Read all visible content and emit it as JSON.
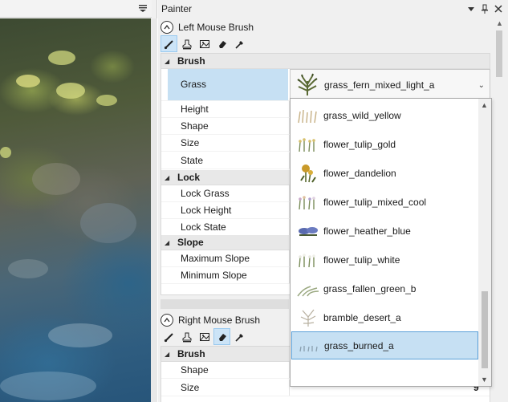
{
  "scene": {
    "menu_icon": "dropdown-menu-icon"
  },
  "painter": {
    "title": "Painter",
    "titlebar_icons": [
      "chevron-down-icon",
      "pin-icon",
      "close-icon"
    ],
    "left_section": {
      "label": "Left Mouse Brush",
      "tools": [
        {
          "name": "brush-tool",
          "icon": "brush-icon",
          "active": true
        },
        {
          "name": "clone-tool",
          "icon": "stamp-icon",
          "active": false
        },
        {
          "name": "image-tool",
          "icon": "picture-icon",
          "active": false
        },
        {
          "name": "eraser-tool",
          "icon": "eraser-icon",
          "active": false
        },
        {
          "name": "picker-tool",
          "icon": "eyedropper-icon",
          "active": false
        }
      ],
      "categories": {
        "brush": "Brush",
        "lock": "Lock",
        "slope": "Slope"
      },
      "rows": {
        "grass": "Grass",
        "height": "Height",
        "shape": "Shape",
        "size": "Size",
        "state": "State",
        "lock_grass": "Lock Grass",
        "lock_height": "Lock Height",
        "lock_state": "Lock State",
        "max_slope": "Maximum Slope",
        "min_slope": "Minimum Slope"
      },
      "grass_value": "grass_fern_mixed_light_a"
    },
    "right_section": {
      "label": "Right Mouse Brush",
      "tools": [
        {
          "name": "brush-tool",
          "icon": "brush-icon",
          "active": false
        },
        {
          "name": "clone-tool",
          "icon": "stamp-icon",
          "active": false
        },
        {
          "name": "image-tool",
          "icon": "picture-icon",
          "active": false
        },
        {
          "name": "eraser-tool",
          "icon": "eraser-icon",
          "active": true
        },
        {
          "name": "picker-tool",
          "icon": "eyedropper-icon",
          "active": false
        }
      ],
      "categories": {
        "brush": "Brush"
      },
      "rows": {
        "shape": "Shape",
        "size": "Size"
      },
      "size_value": "9"
    },
    "dropdown": {
      "items": [
        {
          "label": "grass_wild_yellow",
          "icon": "grass-thumb-icon",
          "selected": false
        },
        {
          "label": "flower_tulip_gold",
          "icon": "tulip-thumb-icon",
          "selected": false
        },
        {
          "label": "flower_dandelion",
          "icon": "dandelion-thumb-icon",
          "selected": false
        },
        {
          "label": "flower_tulip_mixed_cool",
          "icon": "tulip-thumb-icon",
          "selected": false
        },
        {
          "label": "flower_heather_blue",
          "icon": "heather-thumb-icon",
          "selected": false
        },
        {
          "label": "flower_tulip_white",
          "icon": "tulip-thumb-icon",
          "selected": false
        },
        {
          "label": "grass_fallen_green_b",
          "icon": "grass-thumb-icon",
          "selected": false
        },
        {
          "label": "bramble_desert_a",
          "icon": "bramble-thumb-icon",
          "selected": false
        },
        {
          "label": "grass_burned_a",
          "icon": "grass-thumb-icon",
          "selected": true
        }
      ]
    }
  }
}
